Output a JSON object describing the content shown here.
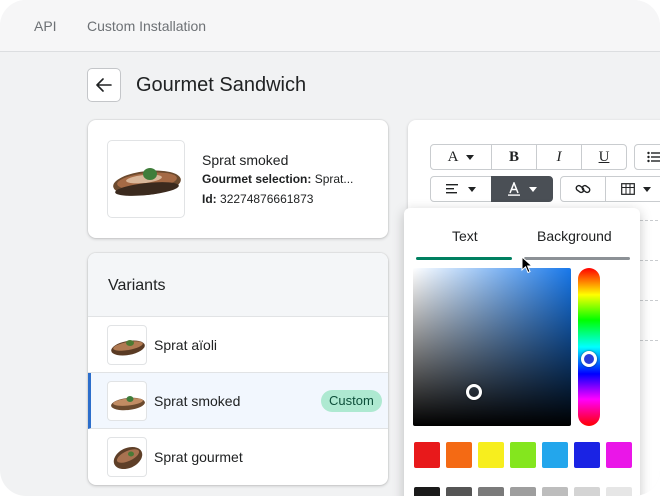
{
  "topnav": {
    "api": "API",
    "custom_installation": "Custom Installation"
  },
  "page": {
    "title": "Gourmet Sandwich"
  },
  "product": {
    "name": "Sprat smoked",
    "selection_label": "Gourmet selection:",
    "selection_value": "Sprat...",
    "id_label": "Id:",
    "id_value": "32274876661873"
  },
  "variants": {
    "title": "Variants",
    "items": [
      {
        "label": "Sprat aïoli",
        "selected": false
      },
      {
        "label": "Sprat smoked",
        "selected": true,
        "badge": "Custom"
      },
      {
        "label": "Sprat gourmet",
        "selected": false
      }
    ]
  },
  "editor": {
    "toolbar": {
      "font": "A",
      "bold": "B",
      "italic": "I",
      "underline": "U"
    }
  },
  "color_picker": {
    "tabs": [
      "Text",
      "Background"
    ],
    "active_tab": "Text",
    "swatches": [
      "#e8191b",
      "#f46a14",
      "#f7ee1e",
      "#84e61e",
      "#23a6ec",
      "#1a23e4",
      "#ea16e8"
    ],
    "grays": [
      "#1a1a1a",
      "#555555",
      "#7a7a7a",
      "#9e9e9e",
      "#bdbdbd",
      "#d4d4d4",
      "#e6e6e6"
    ]
  },
  "colors": {
    "accent": "#2c6ecb",
    "badge_bg": "#aee9d1",
    "badge_text": "#0d4f3a"
  }
}
